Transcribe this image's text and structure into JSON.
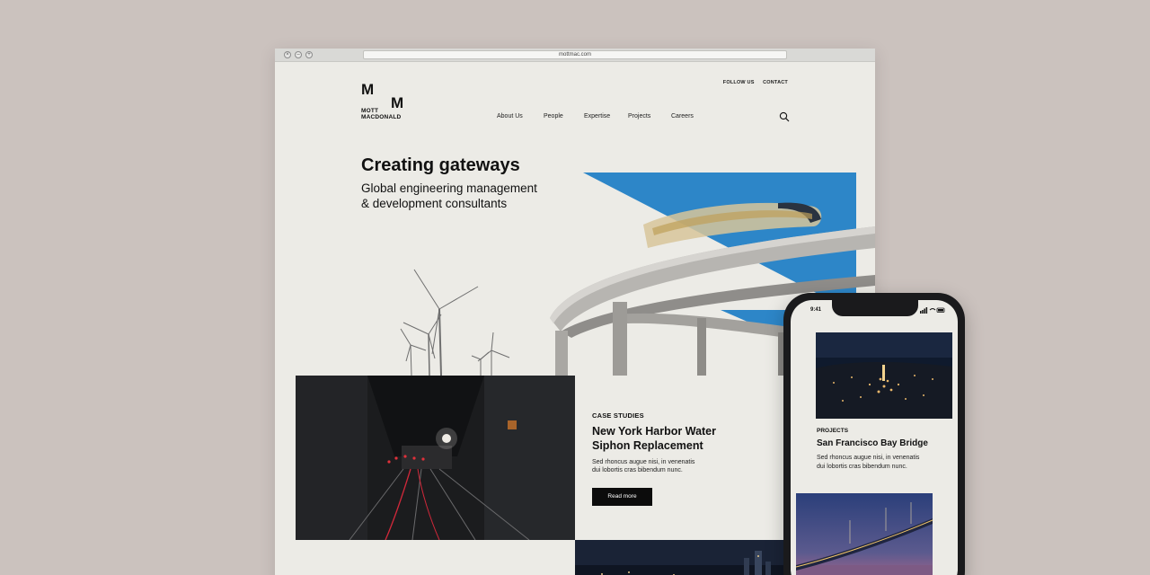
{
  "browser": {
    "url": "mottmac.com"
  },
  "logo": {
    "mark_left": "M",
    "mark_right": "M",
    "line1": "MOTT",
    "line2": "MACDONALD"
  },
  "header": {
    "top_links": [
      "FOLLOW US",
      "CONTACT"
    ],
    "nav": [
      "About Us",
      "People",
      "Expertise",
      "Projects",
      "Careers"
    ],
    "search_icon": "search-icon"
  },
  "hero": {
    "title": "Creating gateways",
    "subtitle_line1": "Global engineering management",
    "subtitle_line2": "& development consultants"
  },
  "case_study": {
    "kicker": "CASE STUDIES",
    "title_line1": "New York Harbor Water",
    "title_line2": "Siphon Replacement",
    "body_line1": "Sed rhoncus augue nisi, in venenatis",
    "body_line2": "dui lobortis cras bibendum nunc.",
    "button": "Read more"
  },
  "phone": {
    "time": "9:41",
    "kicker": "PROJECTS",
    "title": "San Francisco Bay Bridge",
    "body_line1": "Sed rhoncus augue nisi, in venenatis",
    "body_line2": "dui lobortis cras bibendum nunc."
  },
  "colors": {
    "accent_blue": "#2d86c8",
    "background": "#cbc2be",
    "page": "#ecebe6",
    "button": "#0c0c0c"
  }
}
